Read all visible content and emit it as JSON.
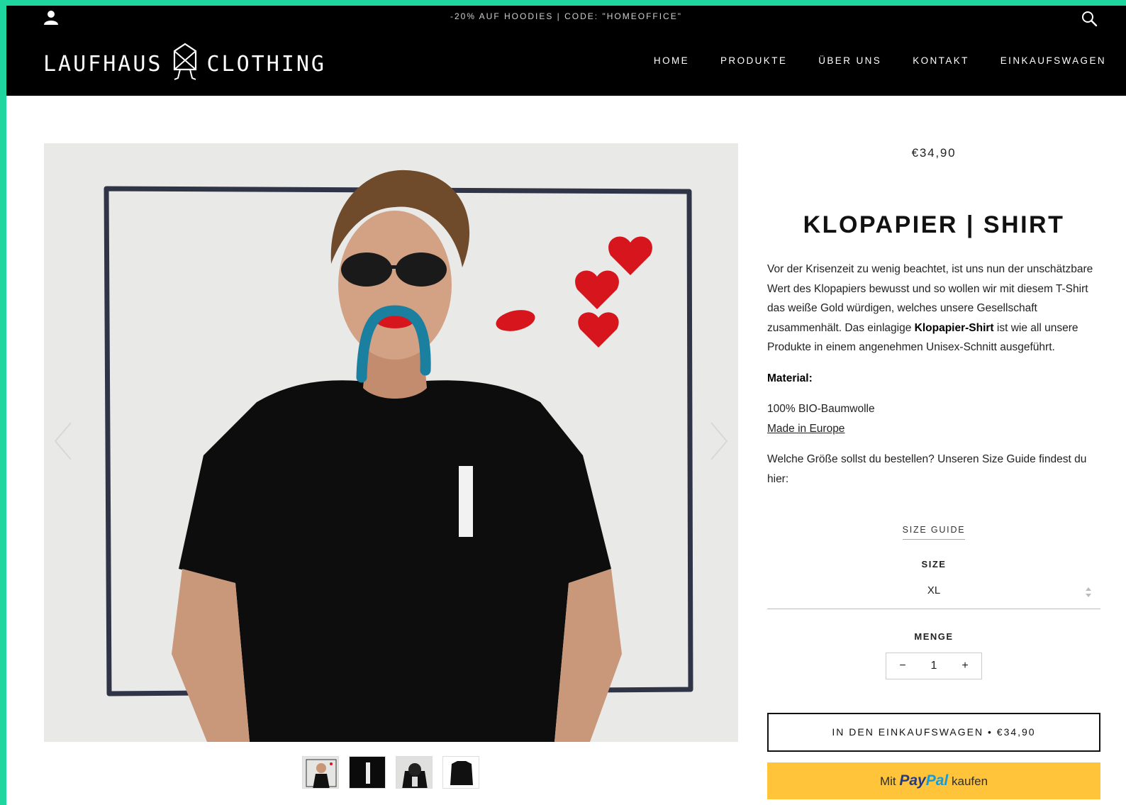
{
  "header": {
    "announcement": "-20% AUF HOODIES | CODE: \"HOMEOFFICE\"",
    "logo_left": "LAUFHAUS",
    "logo_right": "CLOTHING",
    "nav": [
      "HOME",
      "PRODUKTE",
      "ÜBER UNS",
      "KONTAKT",
      "EINKAUFSWAGEN"
    ]
  },
  "product": {
    "price": "€34,90",
    "title": "KLOPAPIER | SHIRT",
    "description_intro": "Vor der Krisenzeit zu wenig beachtet, ist uns nun der unschätzbare Wert des Klopapiers bewusst und so wollen wir mit diesem T-Shirt das weiße Gold würdigen, welches unsere Gesellschaft zusammenhält. Das einlagige ",
    "description_bold": "Klopapier-Shirt",
    "description_outro": " ist wie all unsere Produkte in einem angenehmen Unisex-Schnitt ausgeführt.",
    "material_label": "Material:",
    "material_value": "100% BIO-Baumwolle",
    "made_in_link": "Made in Europe",
    "size_question": "Welche Größe sollst du bestellen? Unseren Size Guide findest du hier:",
    "size_guide_link": "SIZE GUIDE",
    "size_label": "SIZE",
    "size_value": "XL",
    "qty_label": "MENGE",
    "qty_minus": "−",
    "qty_value": "1",
    "qty_plus": "+",
    "cart_button": "IN DEN EINKAUFSWAGEN • €34,90",
    "paypal_prefix": "Mit",
    "paypal_brand_1": "Pay",
    "paypal_brand_2": "Pal",
    "paypal_suffix": "kaufen"
  },
  "colors": {
    "border_accent": "#1fd6a0",
    "header_bg": "#000000",
    "paypal_yellow": "#ffc43a"
  }
}
